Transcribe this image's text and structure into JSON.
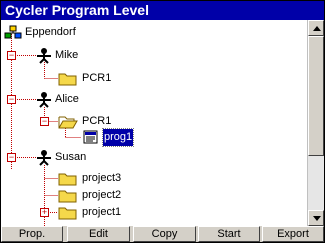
{
  "window": {
    "title": "Cycler Program Level"
  },
  "tree": {
    "root": "Eppendorf",
    "nodes": [
      {
        "label": "Mike",
        "type": "user"
      },
      {
        "label": "PCR1",
        "type": "folder"
      },
      {
        "label": "Alice",
        "type": "user"
      },
      {
        "label": "PCR1",
        "type": "folder-open"
      },
      {
        "label": "prog1",
        "type": "program",
        "selected": true
      },
      {
        "label": "Susan",
        "type": "user"
      },
      {
        "label": "project3",
        "type": "folder"
      },
      {
        "label": "project2",
        "type": "folder"
      },
      {
        "label": "project1",
        "type": "folder"
      }
    ]
  },
  "buttons": {
    "prop": "Prop.",
    "edit": "Edit",
    "copy": "Copy",
    "start": "Start",
    "export": "Export"
  },
  "colors": {
    "titlebar": "#0000a8",
    "selection": "#0000a8",
    "folder": "#f5d84a",
    "expander": "#c00000",
    "button_face": "#d4d0c8"
  }
}
